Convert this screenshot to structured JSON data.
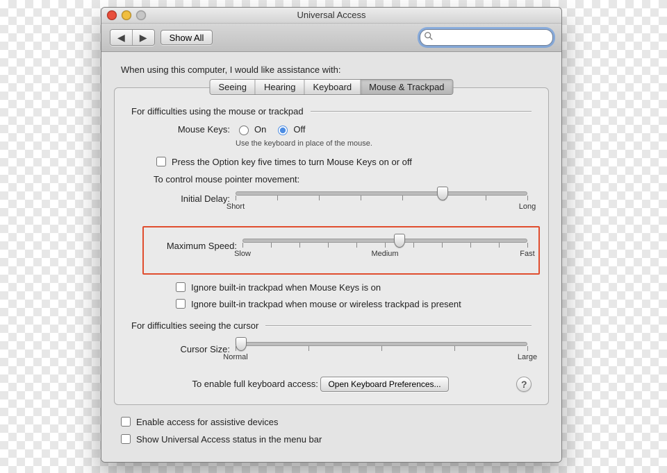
{
  "window": {
    "title": "Universal Access"
  },
  "toolbar": {
    "back_label": "◀",
    "forward_label": "▶",
    "show_all": "Show All",
    "search_placeholder": ""
  },
  "intro": "When using this computer, I would like assistance with:",
  "tabs": {
    "seeing": "Seeing",
    "hearing": "Hearing",
    "keyboard": "Keyboard",
    "mouse": "Mouse & Trackpad"
  },
  "active_tab": "mouse",
  "mouse_section": {
    "heading": "For difficulties using the mouse or trackpad",
    "mouse_keys_label": "Mouse Keys:",
    "on": "On",
    "off": "Off",
    "mouse_keys_value": "off",
    "hint": "Use the keyboard in place of the mouse.",
    "option_key_check": "Press the Option key five times to turn Mouse Keys on or off",
    "control_move_label": "To control mouse pointer movement:",
    "initial_delay": {
      "label": "Initial Delay:",
      "min_label": "Short",
      "max_label": "Long",
      "value_percent": 71
    },
    "max_speed": {
      "label": "Maximum Speed:",
      "min_label": "Slow",
      "mid_label": "Medium",
      "max_label": "Fast",
      "value_percent": 55
    },
    "ignore_trackpad_mousekeys": "Ignore built-in trackpad when Mouse Keys is on",
    "ignore_trackpad_external": "Ignore built-in trackpad when mouse or wireless trackpad is present"
  },
  "cursor_section": {
    "heading": "For difficulties seeing the cursor",
    "cursor_size": {
      "label": "Cursor Size:",
      "min_label": "Normal",
      "max_label": "Large",
      "value_percent": 2
    }
  },
  "keyboard_access": {
    "label": "To enable full keyboard access:",
    "button": "Open Keyboard Preferences..."
  },
  "help_tooltip": "?",
  "bottom": {
    "assistive": "Enable access for assistive devices",
    "menubar": "Show Universal Access status in the menu bar"
  }
}
